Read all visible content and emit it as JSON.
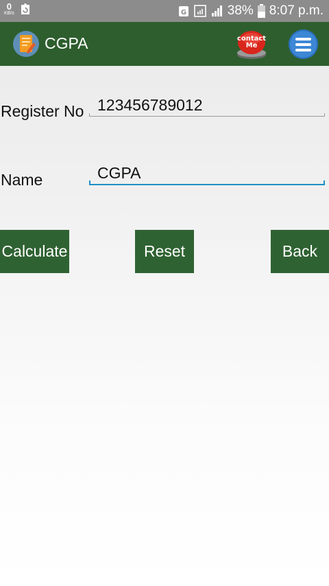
{
  "status_bar": {
    "network_speed_value": "0",
    "network_speed_unit": "KB/s",
    "battery_percent": "38%",
    "time": "8:07 p.m.",
    "icons": [
      "recycle-icon",
      "data-saver-icon",
      "no-sim-icon",
      "signal-icon",
      "battery-icon"
    ]
  },
  "app_bar": {
    "title": "CGPA",
    "contact_button_text_line1": "contact",
    "contact_button_text_line2": "Me",
    "colors": {
      "bar": "#2e5e2e",
      "menu_button": "#3d87d6",
      "contact_button": "#d9261c"
    }
  },
  "form": {
    "register_label": "Register No",
    "register_value": "123456789012",
    "name_label": "Name",
    "name_value": "CGPA",
    "focus_color": "#1c8fc7"
  },
  "buttons": {
    "calculate": "Calculate",
    "reset": "Reset",
    "back": "Back",
    "color": "#2f6232"
  }
}
